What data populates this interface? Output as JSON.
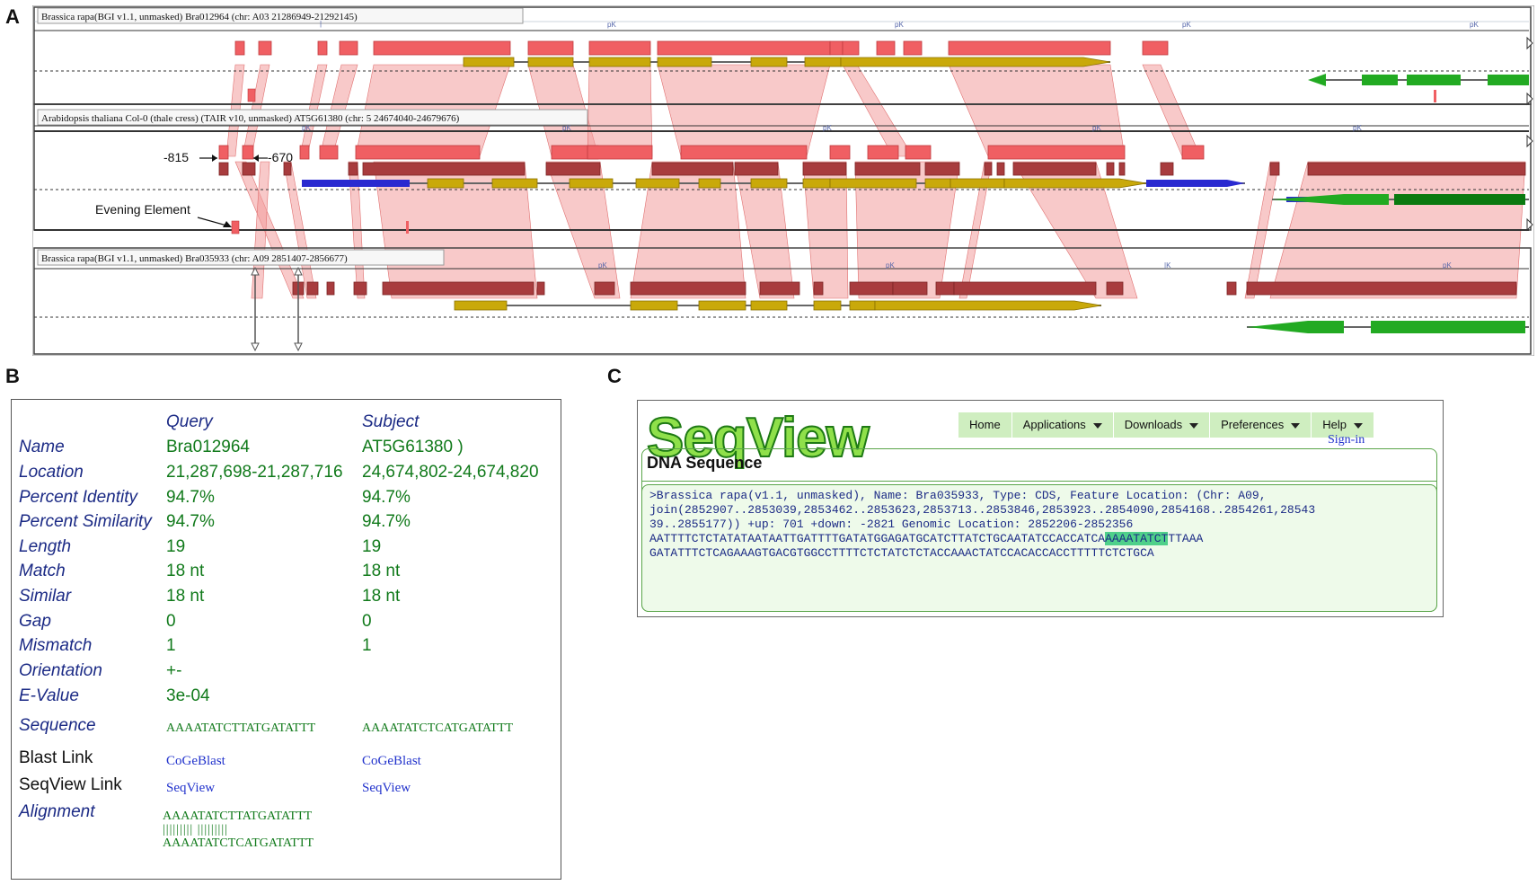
{
  "panel_letters": {
    "a": "A",
    "b": "B",
    "c": "C"
  },
  "panel_a": {
    "tracks": [
      {
        "title": "Brassica rapa(BGI v1.1, unmasked) Bra012964 (chr: A03 21286949-21292145)"
      },
      {
        "title": "Arabidopsis thaliana Col-0 (thale cress) (TAIR v10, unmasked) AT5G61380 (chr: 5 24674040-24679676)"
      },
      {
        "title": "Brassica rapa(BGI v1.1, unmasked) Bra035933 (chr: A09 2851407-2856677)"
      }
    ],
    "annotations": {
      "left": "-815",
      "right": "-670",
      "evening": "Evening Element"
    },
    "colors": {
      "hsp": "#f0686a",
      "hsp_dark": "#a83c3e",
      "link": "#f29c9c",
      "gene": "#c9a90a",
      "blue_gene": "#2a2ad0",
      "green_gene": "#22aa22"
    }
  },
  "panel_b": {
    "header": {
      "query": "Query",
      "subject": "Subject"
    },
    "rows": [
      {
        "label": "Name",
        "query": "Bra012964",
        "subject": "AT5G61380 )"
      },
      {
        "label": "Location",
        "query": "21,287,698-21,287,716",
        "subject": "24,674,802-24,674,820"
      },
      {
        "label": "Percent Identity",
        "query": "94.7%",
        "subject": "94.7%"
      },
      {
        "label": "Percent Similarity",
        "query": "94.7%",
        "subject": "94.7%"
      },
      {
        "label": "Length",
        "query": "19",
        "subject": "19"
      },
      {
        "label": "Match",
        "query": "18 nt",
        "subject": "18 nt"
      },
      {
        "label": "Similar",
        "query": "18 nt",
        "subject": "18 nt"
      },
      {
        "label": "Gap",
        "query": "0",
        "subject": "0"
      },
      {
        "label": "Mismatch",
        "query": "1",
        "subject": "1"
      },
      {
        "label": "Orientation",
        "query": "+-",
        "subject": ""
      },
      {
        "label": "E-Value",
        "query": "3e-04",
        "subject": ""
      }
    ],
    "sequence": {
      "label": "Sequence",
      "query": "AAAATATCTTATGATATTT",
      "subject": "AAAATATCTCATGATATTT"
    },
    "blast_link": {
      "label": "Blast Link",
      "query": "CoGeBlast",
      "subject": "CoGeBlast"
    },
    "seqview_link": {
      "label": "SeqView Link",
      "query": "SeqView",
      "subject": "SeqView"
    },
    "alignment": {
      "label": "Alignment",
      "top": "AAAATATCTTATGATATTT",
      "bars": "||||||||| |||||||||",
      "bottom": "AAAATATCTCATGATATTT"
    }
  },
  "panel_c": {
    "logo": "SeqView",
    "menu": [
      {
        "label": "Home",
        "dropdown": false
      },
      {
        "label": "Applications",
        "dropdown": true
      },
      {
        "label": "Downloads",
        "dropdown": true
      },
      {
        "label": "Preferences",
        "dropdown": true
      },
      {
        "label": "Help",
        "dropdown": true
      }
    ],
    "signin": "Sign-in",
    "dna_title": "DNA Sequence",
    "seq_lines": [
      ">Brassica rapa(v1.1, unmasked), Name: Bra035933, Type: CDS, Feature Location: (Chr: A09,",
      "join(2852907..2853039,2853462..2853623,2853713..2853846,2853923..2854090,2854168..2854261,28543",
      "39..2855177)) +up: 701 +down: -2821 Genomic Location: 2852206-2852356"
    ],
    "seq_line4_pre": "AATTTTCTCTATATAATAATTGATTTTGATATGGAGATGCATCTTATCTGCAATATCCACCATCA",
    "seq_line4_hl": "AAAATATCT",
    "seq_line4_post": "TTAAA",
    "seq_line5": "GATATTTCTCAGAAAGTGACGTGGCCTTTTCTCTATCTCTACCAAACTATCCACACCACCTTTTTCTCTGCA",
    "colors": {
      "menu_bg": "#cfeec0",
      "highlight": "#4fd08a",
      "border": "#5aa54a"
    }
  }
}
